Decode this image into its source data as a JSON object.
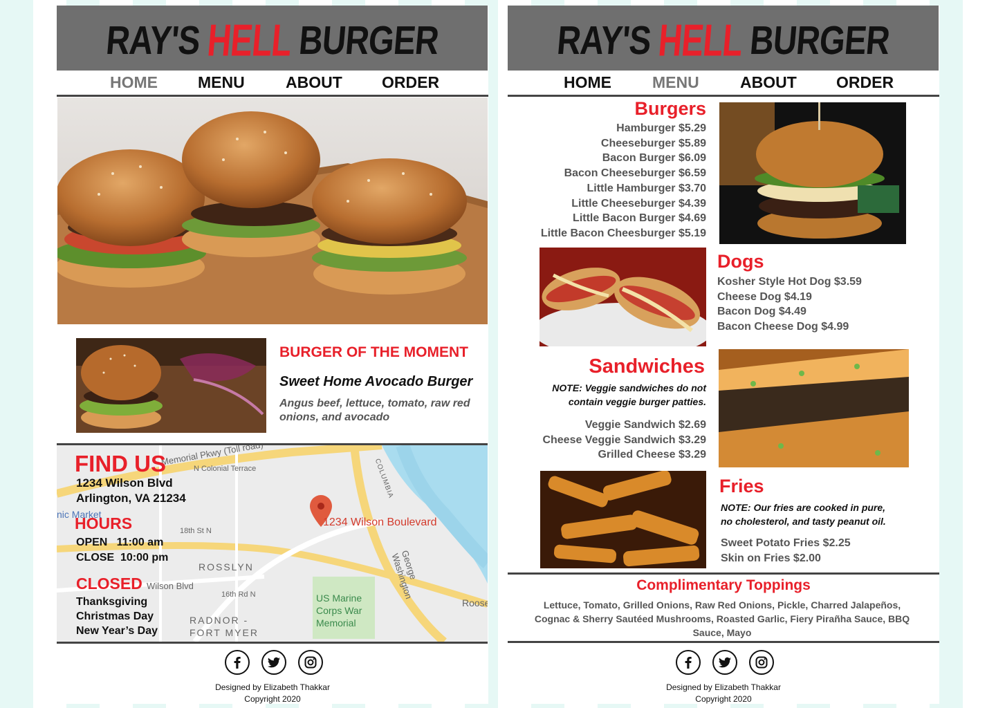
{
  "brand": {
    "word1": "RAY'S",
    "word2": "HELL",
    "word3": "BURGER",
    "accent_color": "#e8202a",
    "banner_color": "#6f6f6f"
  },
  "nav": {
    "items": [
      {
        "label": "HOME"
      },
      {
        "label": "MENU"
      },
      {
        "label": "ABOUT"
      },
      {
        "label": "ORDER"
      }
    ]
  },
  "home": {
    "active_nav": "HOME",
    "burger_of_moment": {
      "heading": "BURGER OF THE MOMENT",
      "name": "Sweet Home Avocado Burger",
      "description": "Angus beef, lettuce, tomato, raw red onions, and avocado"
    },
    "find_us": {
      "heading": "FIND US",
      "address_line1": "1234 Wilson Blvd",
      "address_line2": "Arlington, VA 21234",
      "map_pin_label": "1234 Wilson Boulevard",
      "map_labels": [
        "ROSSLYN",
        "RADNOR - FORT MYER",
        "US Marine Corps War Memorial",
        "George Washington",
        "COLUMBIA",
        "N Colonial Terrace",
        "18th St N",
        "16th Rd N",
        "Wilson Blvd",
        "nic Market",
        "Roosev",
        "Memorial Pkwy (Toll road)"
      ]
    },
    "hours": {
      "heading": "HOURS",
      "open": "OPEN   11:00 am",
      "close": "CLOSE  10:00 pm"
    },
    "closed": {
      "heading": "CLOSED",
      "days": [
        "Thanksgiving",
        "Christmas Day",
        "New Year’s Day"
      ]
    }
  },
  "menu": {
    "active_nav": "MENU",
    "burgers": {
      "heading": "Burgers",
      "items": [
        "Hamburger $5.29",
        "Cheeseburger $5.89",
        "Bacon Burger $6.09",
        "Bacon Cheeseburger $6.59",
        "Little Hamburger $3.70",
        "Little Cheeseburger $4.39",
        "Little Bacon Burger $4.69",
        "Little Bacon Cheesburger $5.19"
      ]
    },
    "dogs": {
      "heading": "Dogs",
      "items": [
        "Kosher Style Hot Dog $3.59",
        "Cheese Dog $4.19",
        "Bacon Dog $4.49",
        "Bacon Cheese Dog $4.99"
      ]
    },
    "sandwiches": {
      "heading": "Sandwiches",
      "note_line1": "NOTE: Veggie sandwiches do not",
      "note_line2": "contain veggie burger patties.",
      "items": [
        "Veggie Sandwich $2.69",
        "Cheese Veggie Sandwich $3.29",
        "Grilled Cheese $3.29"
      ]
    },
    "fries": {
      "heading": "Fries",
      "note_line1": "NOTE: Our fries are cooked in pure,",
      "note_line2": "no cholesterol, and tasty peanut oil.",
      "items": [
        "Sweet Potato Fries $2.25",
        "Skin on Fries $2.00"
      ]
    },
    "toppings": {
      "heading": "Complimentary Toppings",
      "list": "Lettuce, Tomato, Grilled Onions, Raw Red Onions, Pickle, Charred Jalapeños, Cognac & Sherry Sautéed Mushrooms, Roasted Garlic, Fiery Pirañha Sauce, BBQ Sauce, Mayo"
    }
  },
  "footer": {
    "social_icons": [
      "facebook-icon",
      "twitter-icon",
      "instagram-icon"
    ],
    "credit_line1": "Designed by Elizabeth Thakkar",
    "credit_line2": "Copyright 2020"
  }
}
